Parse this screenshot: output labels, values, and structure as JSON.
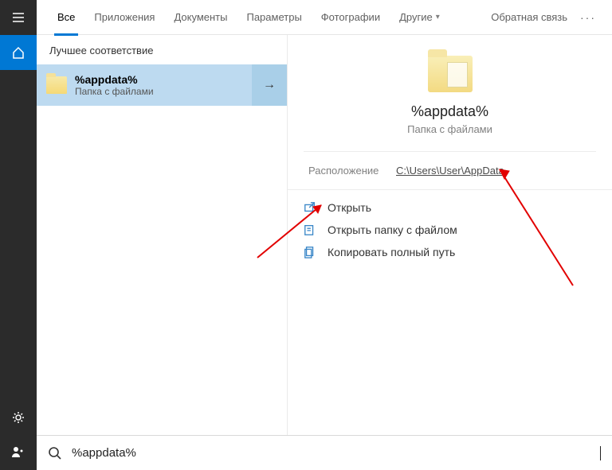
{
  "tabs": {
    "items": [
      {
        "label": "Все",
        "active": true
      },
      {
        "label": "Приложения"
      },
      {
        "label": "Документы"
      },
      {
        "label": "Параметры"
      },
      {
        "label": "Фотографии"
      },
      {
        "label": "Другие",
        "dropdown": true
      }
    ],
    "feedback": "Обратная связь"
  },
  "results": {
    "section_title": "Лучшее соответствие",
    "best_match": {
      "title": "%appdata%",
      "subtitle": "Папка с файлами"
    }
  },
  "preview": {
    "title": "%appdata%",
    "subtitle": "Папка с файлами",
    "location_label": "Расположение",
    "location_value": "C:\\Users\\User\\AppData",
    "actions": {
      "open": "Открыть",
      "open_folder": "Открыть папку с файлом",
      "copy_path": "Копировать полный путь"
    }
  },
  "search": {
    "value": "%appdata%"
  }
}
